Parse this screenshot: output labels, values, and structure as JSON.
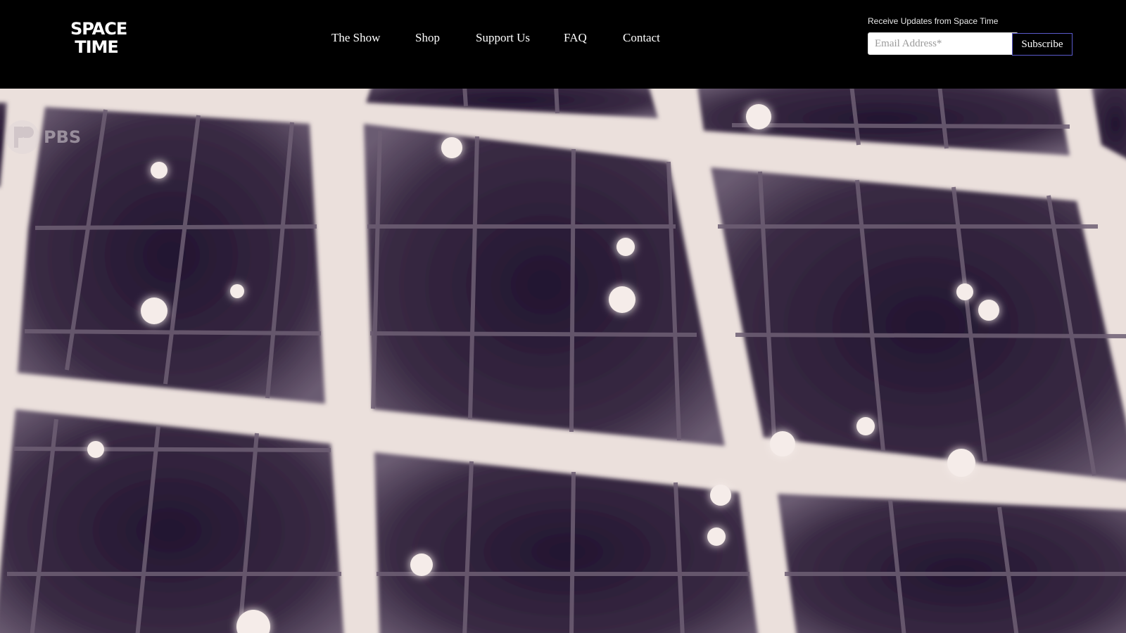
{
  "logo": {
    "line1": "SPACE",
    "line2": "TIME"
  },
  "nav": {
    "items": [
      {
        "label": "The Show"
      },
      {
        "label": "Shop"
      },
      {
        "label": "Support Us"
      },
      {
        "label": "FAQ"
      },
      {
        "label": "Contact"
      }
    ]
  },
  "newsletter": {
    "label": "Receive Updates from Space Time",
    "email_placeholder": "Email Address*",
    "email_value": "",
    "subscribe_label": "Subscribe"
  },
  "hero": {
    "watermark_text": "PBS",
    "watermark_icon": "pbs-head-icon"
  },
  "colors": {
    "header_bg": "#000000",
    "grid_frame": "#ebe0dc",
    "cell_dark": "#2a1b33",
    "button_border": "#5a5acb"
  }
}
